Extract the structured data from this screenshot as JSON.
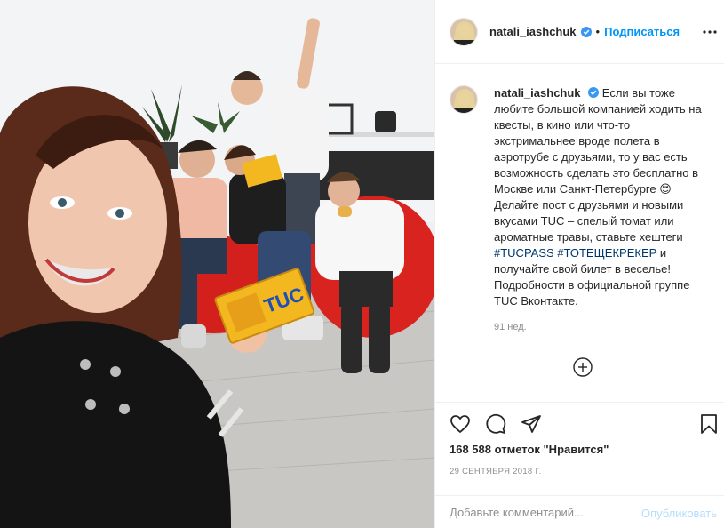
{
  "post": {
    "username": "natali_iashchuk",
    "follow_label": "Подписаться",
    "separator": "•",
    "caption_pre": "Если вы тоже любите большой компанией ходить на квесты, в кино или что-то экстримальнее вроде полета в аэротрубе с друзьями, то у вас есть возможность сделать это бесплатно в Москве или Санкт-Петербурге 😍 Делайте пост с друзьями и новыми вкусами TUC – спелый томат или ароматные травы, ставьте хештеги ",
    "hashtag_1": "#TUCPASS",
    "hashtag_2": "#ТОТЕЩЕКРЕКЕР",
    "caption_post": " и получайте свой билет в веселье! Подробности в официальной группе TUC Вконтакте.",
    "time_ago": "91 нед.",
    "likes": "168 588 отметок \"Нравится\"",
    "date": "29 СЕНТЯБРЯ 2018 Г.",
    "comment_placeholder": "Добавьте комментарий...",
    "publish_label": "Опубликовать"
  },
  "photo": {
    "package_brand": "TUC"
  },
  "icons": {
    "verified": "verified-badge-icon",
    "more": "more-options-icon",
    "add": "add-plus-icon",
    "like": "heart-icon",
    "comment": "comment-icon",
    "share": "share-icon",
    "save": "bookmark-icon"
  },
  "colors": {
    "link": "#0095f6",
    "hashtag": "#00376b",
    "muted": "#8e8e8e",
    "publish_disabled": "#b2dffc"
  }
}
